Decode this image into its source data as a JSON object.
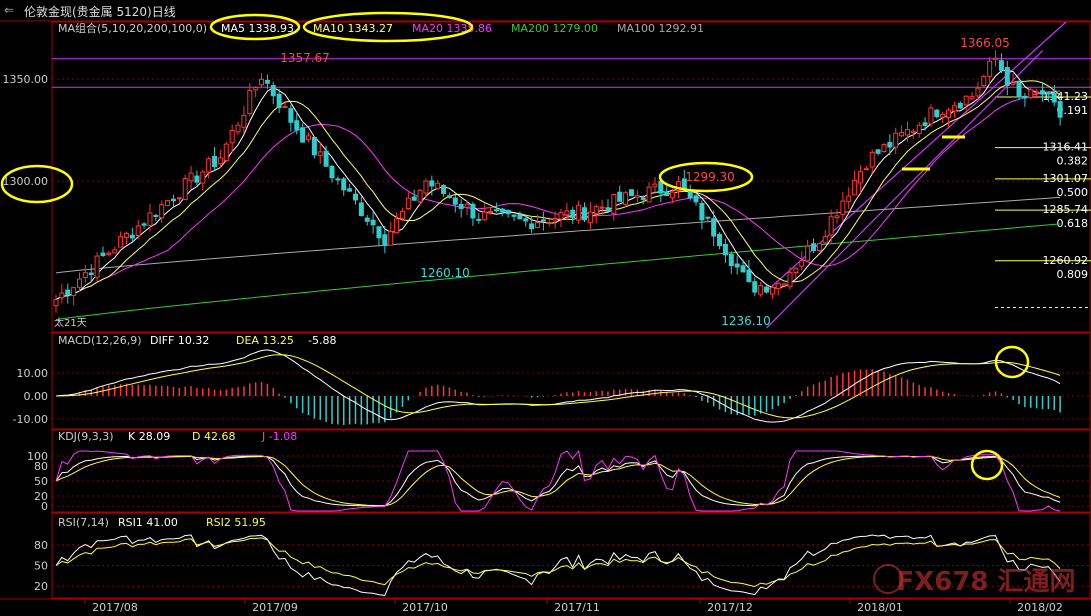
{
  "window": {
    "title": "伦敦金现(贵金属 5120)日线",
    "back_icon": "back-arrow-icon"
  },
  "ma_legend": {
    "group": "MA组合(5,10,20,200,100,0)",
    "items": [
      {
        "label": "MA5 1338.93",
        "color": "#ffffff"
      },
      {
        "label": "MA10 1343.27",
        "color": "#ffff66"
      },
      {
        "label": "MA20 1335.86",
        "color": "#ff33ff"
      },
      {
        "label": "MA200 1279.00",
        "color": "#33cc33"
      },
      {
        "label": "MA100 1292.91",
        "color": "#aaaaaa"
      }
    ]
  },
  "macd_legend": {
    "name": "MACD(12,26,9)",
    "diff": "DIFF  10.32",
    "dea": "DEA  13.25",
    "macd": "-5.88"
  },
  "kdj_legend": {
    "name": "KDJ(9,3,3)",
    "k": "K  28.09",
    "d": "D  42.68",
    "j": "J  -1.08"
  },
  "rsi_legend": {
    "name": "RSI(7,14)",
    "rsi1": "RSI1  41.00",
    "rsi2": "RSI2  51.95"
  },
  "chart_data": {
    "type": "candlestick",
    "price_axis": {
      "ticks": [
        "1350.00",
        "1300.00"
      ],
      "ylim": [
        1226,
        1378
      ]
    },
    "macd_axis": {
      "ticks": [
        "10.00",
        "0.00",
        "-10.00"
      ]
    },
    "kdj_axis": {
      "ticks": [
        "100",
        "80",
        "50",
        "20",
        "0"
      ]
    },
    "rsi_axis": {
      "ticks": [
        "80",
        "50",
        "20"
      ]
    },
    "x_ticks": [
      "2017/08",
      "2017/09",
      "2017/10",
      "2017/11",
      "2017/12",
      "2018/01",
      "2018/02"
    ],
    "price_labels": [
      {
        "text": "1357.67",
        "color": "#ff4444"
      },
      {
        "text": "1260.10",
        "color": "#33dddd"
      },
      {
        "text": "1299.30",
        "color": "#ff4444"
      },
      {
        "text": "1236.10",
        "color": "#33dddd"
      },
      {
        "text": "1366.05",
        "color": "#ff4444"
      }
    ],
    "fib_levels": [
      {
        "price": "1341.23",
        "ratio": "0.191"
      },
      {
        "price": "1316.41",
        "ratio": "0.382"
      },
      {
        "price": "1301.07",
        "ratio": "0.500"
      },
      {
        "price": "1285.74",
        "ratio": "0.618"
      },
      {
        "price": "1260.92",
        "ratio": "0.809"
      }
    ],
    "start_label": "太21天",
    "anchors": [
      {
        "i": 0,
        "v": 1242
      },
      {
        "i": 10,
        "v": 1268
      },
      {
        "i": 20,
        "v": 1293
      },
      {
        "i": 28,
        "v": 1312
      },
      {
        "i": 35,
        "v": 1352
      },
      {
        "i": 40,
        "v": 1330
      },
      {
        "i": 48,
        "v": 1300
      },
      {
        "i": 56,
        "v": 1272
      },
      {
        "i": 63,
        "v": 1300
      },
      {
        "i": 72,
        "v": 1283
      },
      {
        "i": 80,
        "v": 1280
      },
      {
        "i": 90,
        "v": 1285
      },
      {
        "i": 100,
        "v": 1294
      },
      {
        "i": 106,
        "v": 1298
      },
      {
        "i": 113,
        "v": 1272
      },
      {
        "i": 118,
        "v": 1248
      },
      {
        "i": 123,
        "v": 1250
      },
      {
        "i": 130,
        "v": 1272
      },
      {
        "i": 138,
        "v": 1310
      },
      {
        "i": 144,
        "v": 1322
      },
      {
        "i": 150,
        "v": 1335
      },
      {
        "i": 156,
        "v": 1342
      },
      {
        "i": 160,
        "v": 1360
      },
      {
        "i": 164,
        "v": 1340
      },
      {
        "i": 168,
        "v": 1343
      },
      {
        "i": 171,
        "v": 1332
      }
    ]
  },
  "watermark": "FX678 汇通网",
  "colors": {
    "up": "#ff3333",
    "down": "#33cccc",
    "ma5": "#ffffff",
    "ma10": "#ffff66",
    "ma20": "#ff33ff",
    "ma100": "#aaaaaa",
    "ma200": "#33cc33",
    "grid": "#880000",
    "highlight": "#ffff00",
    "channel": "#cc33ff"
  }
}
